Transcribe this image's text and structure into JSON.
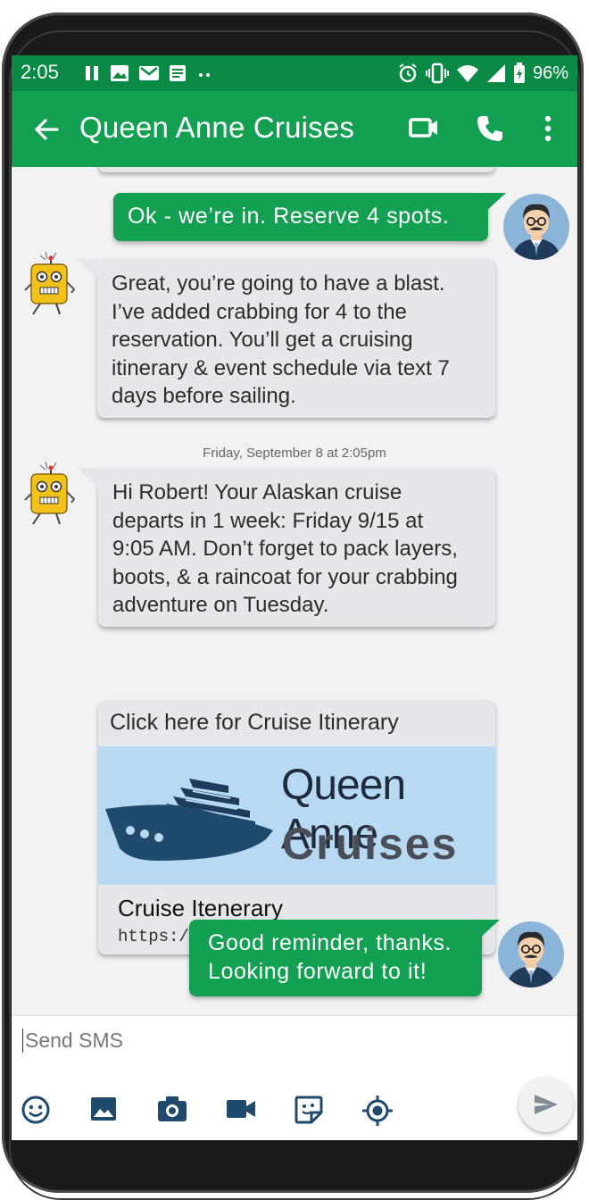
{
  "status": {
    "time": "2:05",
    "battery": "96%"
  },
  "header": {
    "title": "Queen Anne Cruises"
  },
  "messages": {
    "m1": "Ok - we’re in. Reserve 4 spots.",
    "m2": "Great, you’re going to have a blast.\nI’ve added crabbing for 4 to the\nreservation. You’ll get a cruising\nitinerary & event schedule via text 7\ndays before sailing.",
    "date": "Friday, September 8 at 2:05pm",
    "m3": "Hi Robert! Your Alaskan cruise\ndeparts in 1 week: Friday 9/15 at\n9:05 AM. Don’t forget to pack layers,\nboots, & a raincoat for your crabbing\nadventure on Tuesday.",
    "card": {
      "cta": "Click here for Cruise Itinerary",
      "brand_line1": "Queen Anne",
      "brand_line2": "Cruises",
      "link_title": "Cruise Itenerary",
      "url": "https://cruise.chatbox.com/AK49g"
    },
    "m4": "Good reminder, thanks.\nLooking forward to it!"
  },
  "composer": {
    "placeholder": "Send SMS"
  },
  "icons": {
    "status": [
      "pause-icon",
      "image-icon",
      "gmail-icon",
      "notes-icon",
      "more-dots-icon",
      "alarm-icon",
      "vibrate-icon",
      "wifi-icon",
      "signal-icon",
      "battery-icon"
    ],
    "header": [
      "back-arrow-icon",
      "video-call-icon",
      "phone-call-icon",
      "overflow-menu-icon"
    ],
    "toolbar": [
      "emoji-icon",
      "gallery-icon",
      "camera-icon",
      "video-icon",
      "sticker-icon",
      "location-icon",
      "send-icon"
    ]
  },
  "colors": {
    "status_bar": "#0b8a45",
    "app_bar": "#13a052",
    "incoming_bubble": "#e6e7eb",
    "outgoing_bubble": "#13a052"
  }
}
